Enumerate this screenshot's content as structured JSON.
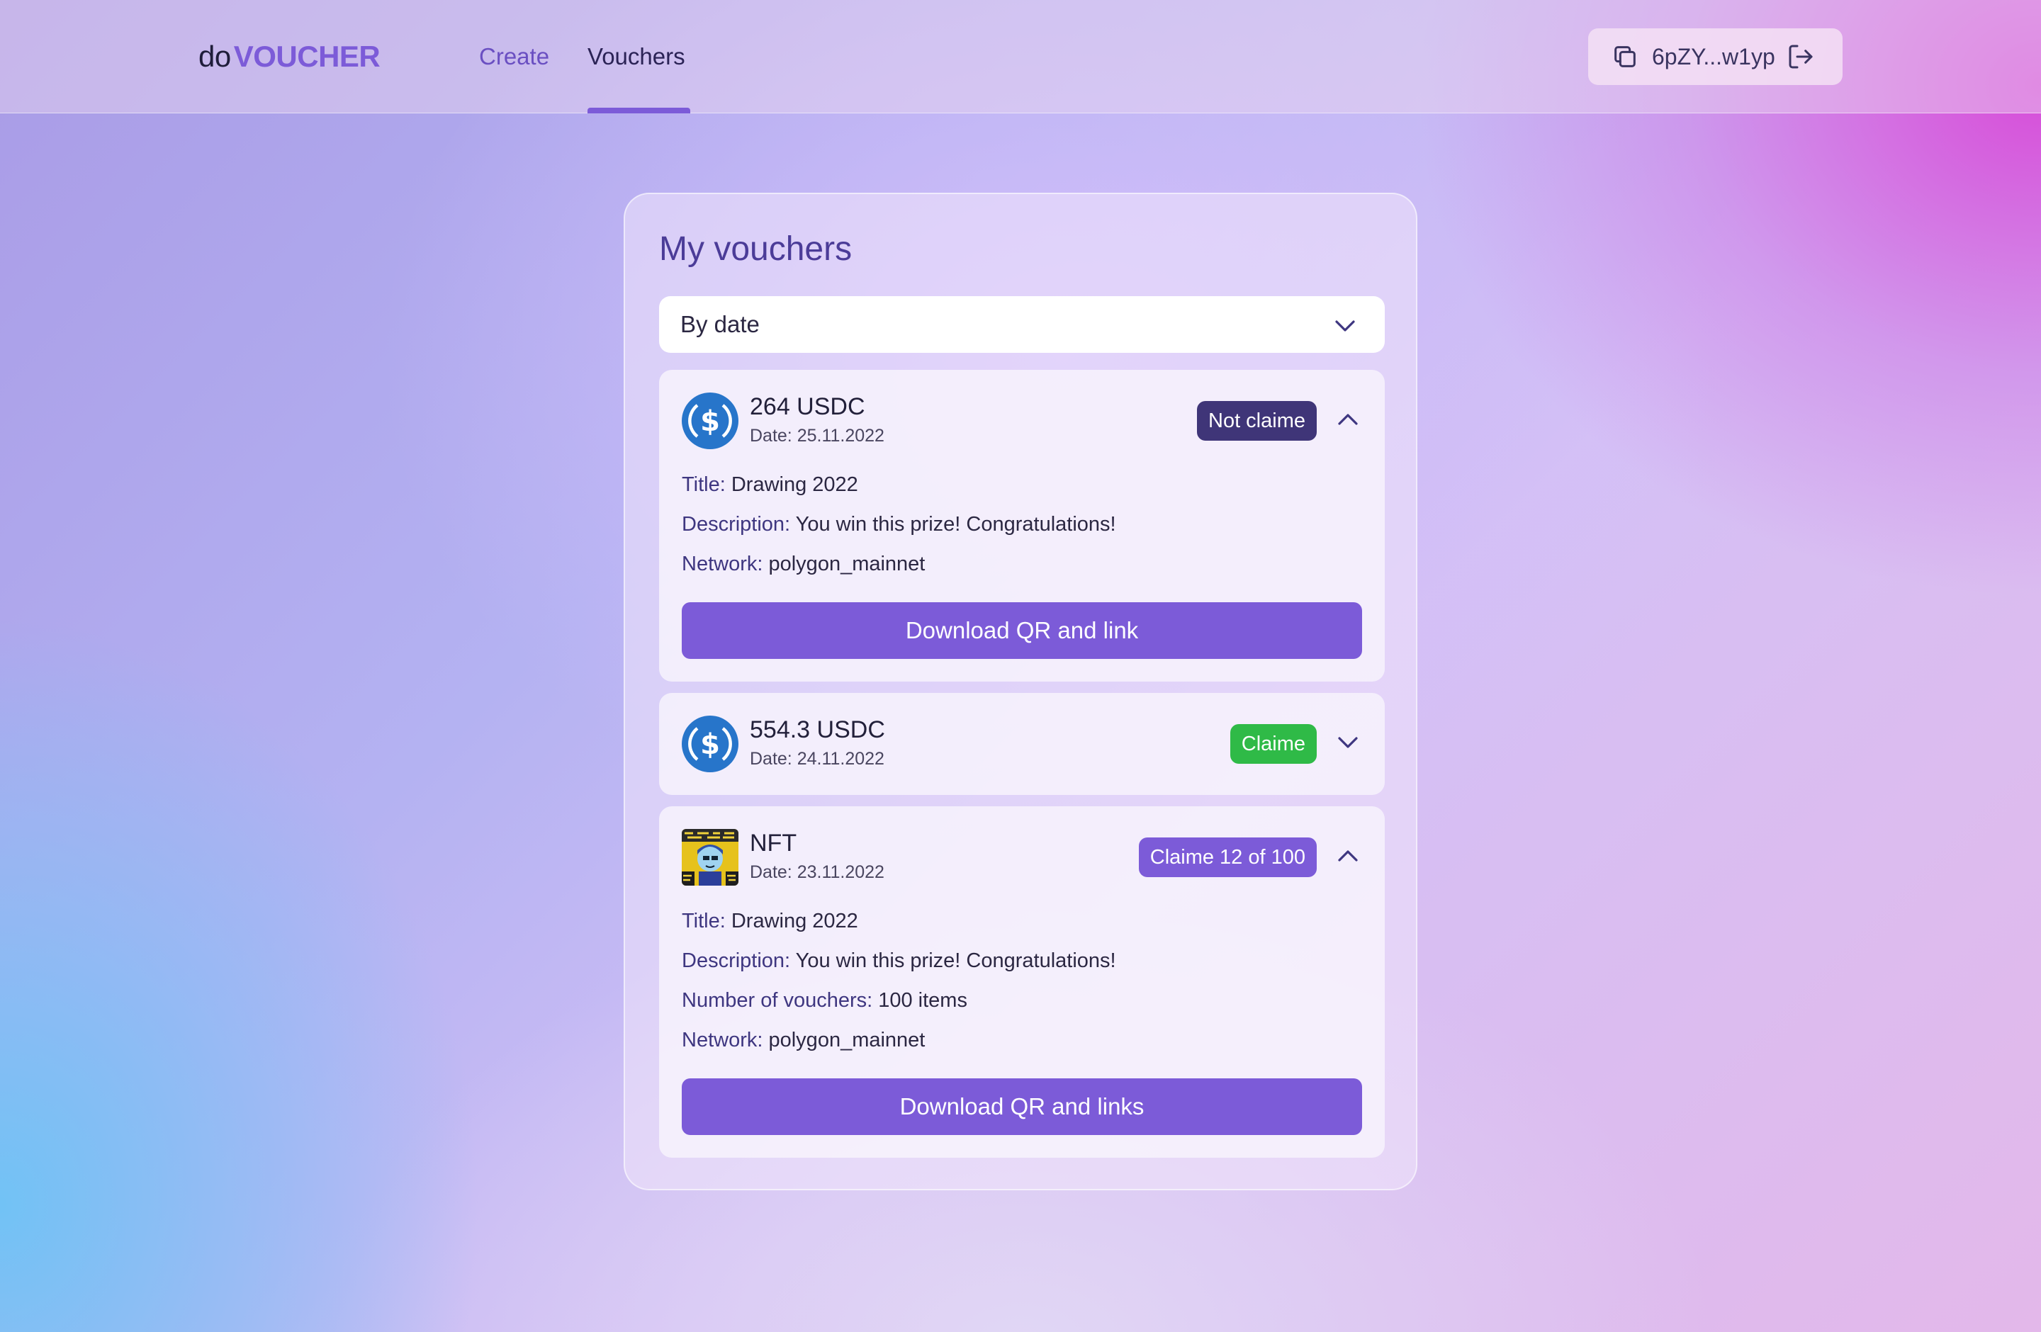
{
  "header": {
    "logo_prefix": "do",
    "logo_brand": "VOUCHER",
    "nav": [
      {
        "label": "Create",
        "active": false
      },
      {
        "label": "Vouchers",
        "active": true
      }
    ],
    "wallet": {
      "address": "6pZY...w1yp",
      "copy_icon": "copy-icon",
      "logout_icon": "logout-icon"
    }
  },
  "main": {
    "title": "My vouchers",
    "sort": {
      "selected": "By date",
      "icon": "chevron-down-icon"
    },
    "vouchers": [
      {
        "amount": "264 USDC",
        "date": "Date: 25.11.2022",
        "icon": "usdc-icon",
        "status": "Not claime",
        "status_color": "#3f3578",
        "expanded": true,
        "details": [
          {
            "key": "Title:",
            "value": "Drawing 2022"
          },
          {
            "key": "Description:",
            "value": "You win this prize! Congratulations!"
          },
          {
            "key": "Network:",
            "value": "polygon_mainnet"
          }
        ],
        "button": "Download QR and link"
      },
      {
        "amount": "554.3 USDC",
        "date": "Date: 24.11.2022",
        "icon": "usdc-icon",
        "status": "Claime",
        "status_color": "#2fba47",
        "expanded": false
      },
      {
        "amount": "NFT",
        "date": "Date: 23.11.2022",
        "icon": "nft-image",
        "status": "Claime 12 of 100",
        "status_color": "#7c5bd8",
        "expanded": true,
        "details": [
          {
            "key": "Title:",
            "value": "Drawing 2022"
          },
          {
            "key": "Description:",
            "value": "You win this prize! Congratulations!"
          },
          {
            "key": "Number of vouchers:",
            "value": "100 items"
          },
          {
            "key": "Network:",
            "value": "polygon_mainnet"
          }
        ],
        "button": "Download QR and links"
      }
    ]
  },
  "colors": {
    "accent": "#7c5bd8",
    "usdc": "#2775ca"
  }
}
